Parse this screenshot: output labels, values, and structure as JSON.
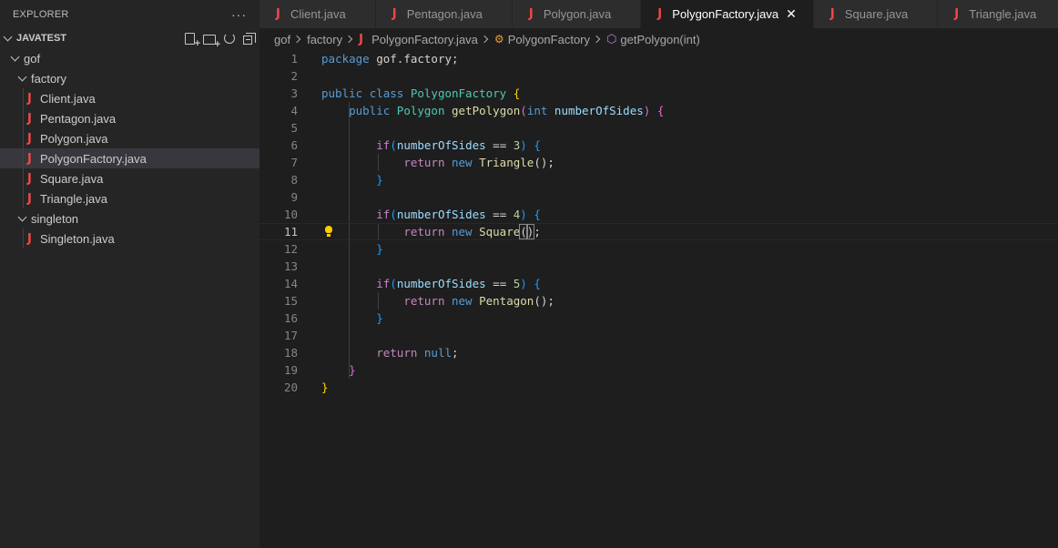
{
  "explorer": {
    "title": "EXPLORER",
    "more_label": "···",
    "project": "JAVATEST",
    "tree": [
      {
        "label": "gof",
        "type": "folder",
        "depth": 1
      },
      {
        "label": "factory",
        "type": "folder",
        "depth": 2
      },
      {
        "label": "Client.java",
        "type": "java",
        "depth": 3
      },
      {
        "label": "Pentagon.java",
        "type": "java",
        "depth": 3
      },
      {
        "label": "Polygon.java",
        "type": "java",
        "depth": 3
      },
      {
        "label": "PolygonFactory.java",
        "type": "java",
        "depth": 3,
        "selected": true
      },
      {
        "label": "Square.java",
        "type": "java",
        "depth": 3
      },
      {
        "label": "Triangle.java",
        "type": "java",
        "depth": 3
      },
      {
        "label": "singleton",
        "type": "folder",
        "depth": 2
      },
      {
        "label": "Singleton.java",
        "type": "java",
        "depth": 3
      }
    ]
  },
  "tabs": [
    {
      "label": "Client.java",
      "active": false
    },
    {
      "label": "Pentagon.java",
      "active": false
    },
    {
      "label": "Polygon.java",
      "active": false
    },
    {
      "label": "PolygonFactory.java",
      "active": true
    },
    {
      "label": "Square.java",
      "active": false
    },
    {
      "label": "Triangle.java",
      "active": false
    }
  ],
  "java_glyph": "J",
  "close_glyph": "✕",
  "breadcrumb": {
    "parts": [
      "gof",
      "factory",
      "PolygonFactory.java",
      "PolygonFactory",
      "getPolygon(int)"
    ]
  },
  "editor": {
    "current_line": 11,
    "lines": [
      [
        [
          "kw",
          "package "
        ],
        [
          "pl",
          "gof.factory;"
        ]
      ],
      [],
      [
        [
          "kw",
          "public "
        ],
        [
          "kw",
          "class "
        ],
        [
          "cls",
          "PolygonFactory "
        ],
        [
          "b1",
          "{"
        ]
      ],
      [
        [
          "pl",
          "    "
        ],
        [
          "kw",
          "public "
        ],
        [
          "cls",
          "Polygon "
        ],
        [
          "fn",
          "getPolygon"
        ],
        [
          "b2",
          "("
        ],
        [
          "kw",
          "int "
        ],
        [
          "var",
          "numberOfSides"
        ],
        [
          "b2",
          ")"
        ],
        [
          "pl",
          " "
        ],
        [
          "b2",
          "{"
        ]
      ],
      [],
      [
        [
          "pl",
          "        "
        ],
        [
          "kw2",
          "if"
        ],
        [
          "b3",
          "("
        ],
        [
          "var",
          "numberOfSides"
        ],
        [
          "pl",
          " == "
        ],
        [
          "num",
          "3"
        ],
        [
          "b3",
          ")"
        ],
        [
          "pl",
          " "
        ],
        [
          "b3",
          "{"
        ]
      ],
      [
        [
          "pl",
          "            "
        ],
        [
          "kw2",
          "return "
        ],
        [
          "kw",
          "new "
        ],
        [
          "fn",
          "Triangle"
        ],
        [
          "pl",
          "();"
        ]
      ],
      [
        [
          "pl",
          "        "
        ],
        [
          "b3",
          "}"
        ]
      ],
      [],
      [
        [
          "pl",
          "        "
        ],
        [
          "kw2",
          "if"
        ],
        [
          "b3",
          "("
        ],
        [
          "var",
          "numberOfSides"
        ],
        [
          "pl",
          " == "
        ],
        [
          "num",
          "4"
        ],
        [
          "b3",
          ")"
        ],
        [
          "pl",
          " "
        ],
        [
          "b3",
          "{"
        ]
      ],
      [
        [
          "pl",
          "            "
        ],
        [
          "kw2",
          "return "
        ],
        [
          "kw",
          "new "
        ],
        [
          "fn",
          "Square"
        ],
        [
          "match",
          "("
        ],
        [
          "match",
          ")"
        ],
        [
          "pl",
          ";"
        ]
      ],
      [
        [
          "pl",
          "        "
        ],
        [
          "b3",
          "}"
        ]
      ],
      [],
      [
        [
          "pl",
          "        "
        ],
        [
          "kw2",
          "if"
        ],
        [
          "b3",
          "("
        ],
        [
          "var",
          "numberOfSides"
        ],
        [
          "pl",
          " == "
        ],
        [
          "num",
          "5"
        ],
        [
          "b3",
          ")"
        ],
        [
          "pl",
          " "
        ],
        [
          "b3",
          "{"
        ]
      ],
      [
        [
          "pl",
          "            "
        ],
        [
          "kw2",
          "return "
        ],
        [
          "kw",
          "new "
        ],
        [
          "fn",
          "Pentagon"
        ],
        [
          "pl",
          "();"
        ]
      ],
      [
        [
          "pl",
          "        "
        ],
        [
          "b3",
          "}"
        ]
      ],
      [],
      [
        [
          "pl",
          "        "
        ],
        [
          "kw2",
          "return "
        ],
        [
          "kw",
          "null"
        ],
        [
          "pl",
          ";"
        ]
      ],
      [
        [
          "pl",
          "    "
        ],
        [
          "b2",
          "}"
        ]
      ],
      [
        [
          "b1",
          "}"
        ]
      ]
    ]
  },
  "colors": {
    "background": "#1e1e1e",
    "sidebar": "#252526",
    "selected_row": "#37373d",
    "java_icon": "#f44747",
    "keyword": "#569cd6",
    "control_keyword": "#c586c0",
    "type": "#4ec9b0",
    "function": "#dcdcaa",
    "variable": "#9cdcfe",
    "number": "#b5cea8"
  }
}
